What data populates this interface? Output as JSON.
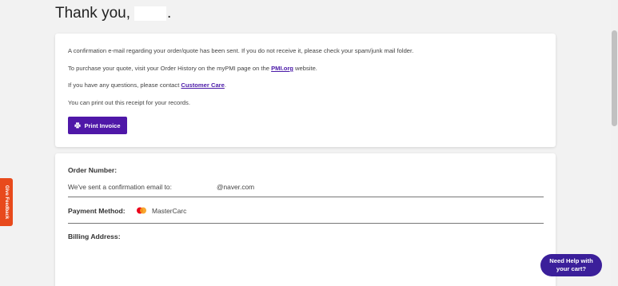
{
  "header": {
    "thank_prefix": "Thank you,",
    "thank_suffix": "."
  },
  "confirmation": {
    "line1": "A confirmation e-mail regarding your order/quote has been sent. If you do not receive it, please check your spam/junk mail folder.",
    "line2_prefix": "To purchase your quote, visit your Order History on the myPMI page on the ",
    "line2_link": "PMI.org",
    "line2_suffix": " website.",
    "line3_prefix": "If you have any questions, please contact ",
    "line3_link": "Customer Care",
    "line3_suffix": ".",
    "line4": "You can print out this receipt for your records.",
    "print_button": "Print Invoice"
  },
  "order": {
    "order_number_label": "Order Number:",
    "email_sent_label": "We've sent a confirmation email to:",
    "email_value": "@naver.com",
    "payment_label": "Payment Method:",
    "payment_value": "MasterCarc",
    "billing_label": "Billing Address:"
  },
  "feedback": {
    "label": "Give Feedback"
  },
  "help_chat": {
    "line1": "Need Help with",
    "line2": "your cart?"
  },
  "icons": [
    "print-icon",
    "mastercard-icon",
    "feedback-icon"
  ]
}
